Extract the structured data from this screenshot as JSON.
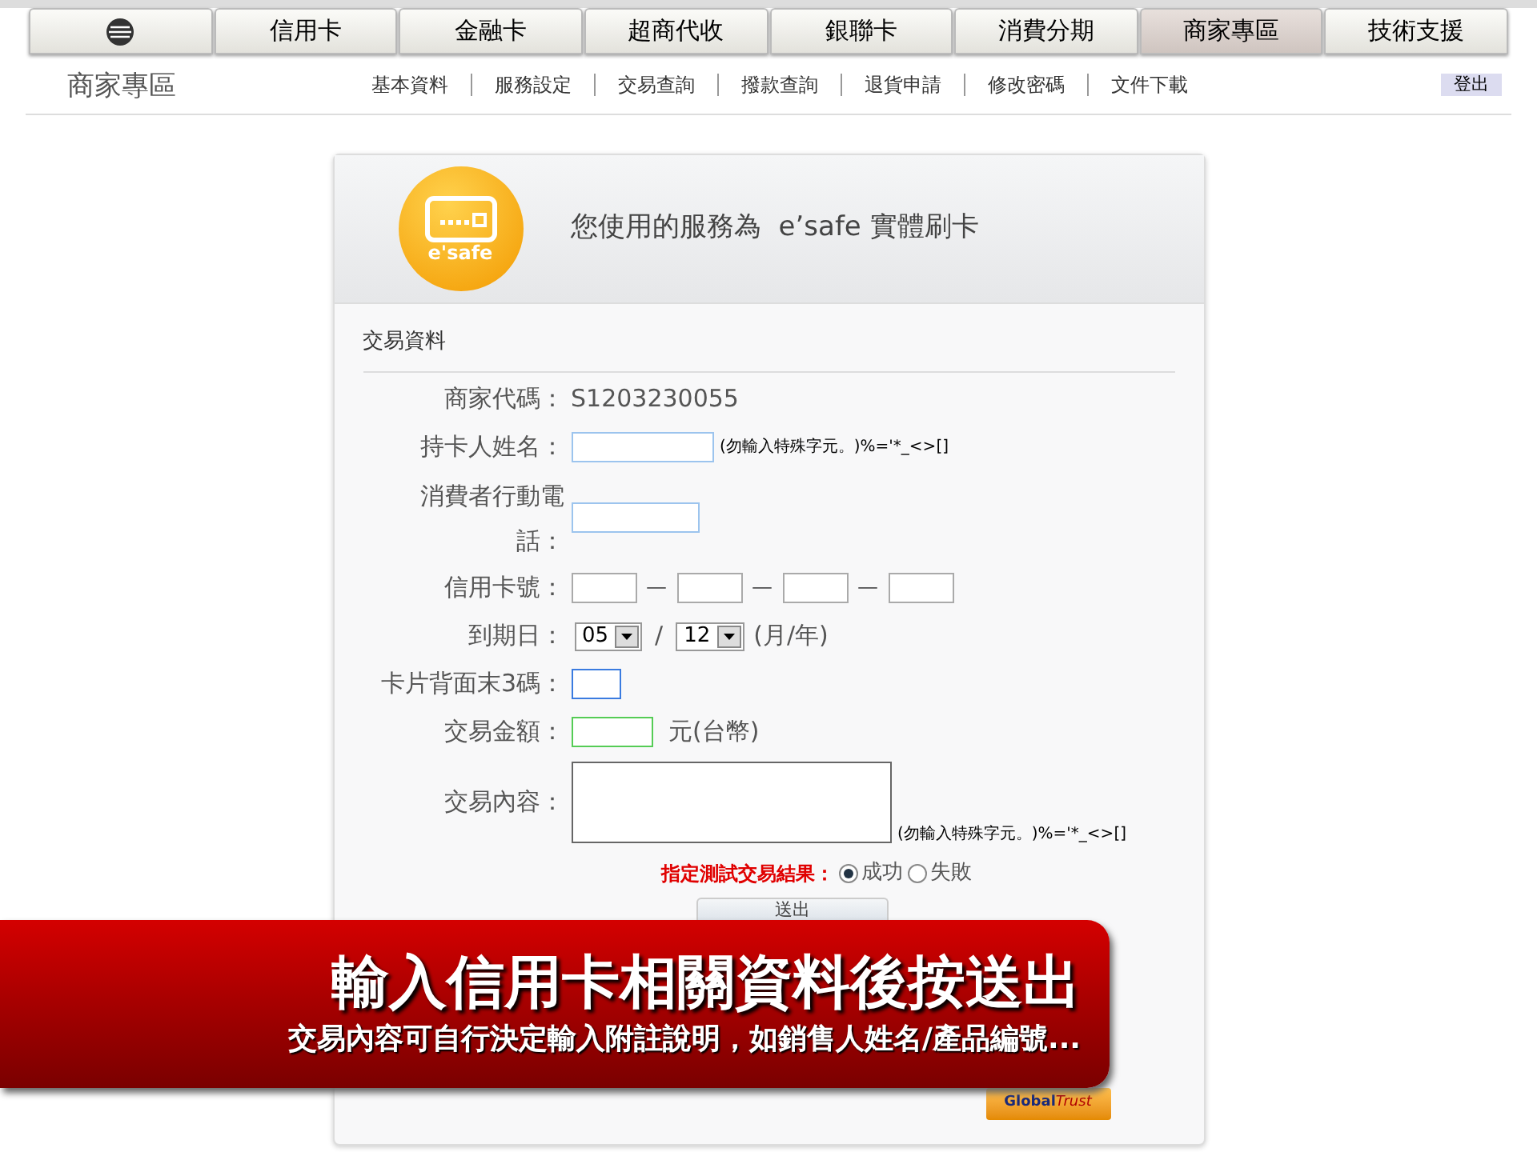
{
  "nav_tabs": [
    {
      "kind": "icon",
      "selected": false
    },
    {
      "kind": "text",
      "label": "信用卡",
      "selected": false
    },
    {
      "kind": "text",
      "label": "金融卡",
      "selected": false
    },
    {
      "kind": "text",
      "label": "超商代收",
      "selected": false
    },
    {
      "kind": "text",
      "label": "銀聯卡",
      "selected": false
    },
    {
      "kind": "text",
      "label": "消費分期",
      "selected": false
    },
    {
      "kind": "text",
      "label": "商家專區",
      "selected": true
    },
    {
      "kind": "text",
      "label": "技術支援",
      "selected": false
    }
  ],
  "section_title": "商家專區",
  "sub_links": [
    "基本資料",
    "服務設定",
    "交易查詢",
    "撥款查詢",
    "退貨申請",
    "修改密碼",
    "文件下載"
  ],
  "logout": "登出",
  "card": {
    "logo_text": "e'safe",
    "heading": "您使用的服務為  e’safe 實體刷卡",
    "section": "交易資料",
    "rows": [
      {
        "kind": "value",
        "label": "商家代碼：",
        "value": "S1203230055"
      },
      {
        "kind": "text_hint",
        "label": "持卡人姓名：",
        "hint": "(勿輸入特殊字元。)%='*_<>[]"
      },
      {
        "kind": "phone",
        "label_lines": [
          "消費者行動電",
          "話："
        ]
      },
      {
        "kind": "card_number",
        "label": "信用卡號：",
        "separator": "—"
      },
      {
        "kind": "expiry",
        "label": "到期日：",
        "month": "05",
        "year": "12",
        "slash": "/",
        "unit": "(月/年)"
      },
      {
        "kind": "cvv",
        "label": "卡片背面末3碼："
      },
      {
        "kind": "amount",
        "label": "交易金額：",
        "unit": "元(台幣)"
      },
      {
        "kind": "textarea",
        "label": "交易內容：",
        "hint": "(勿輸入特殊字元。)%='*_<>[]"
      }
    ],
    "result": {
      "label": "指定測試交易結果：",
      "options": [
        {
          "label": "成功",
          "selected": true
        },
        {
          "label": "失敗",
          "selected": false
        }
      ]
    },
    "submit": "送出",
    "badge": {
      "part_1": "Global",
      "part_2": "Trust"
    }
  },
  "banner": {
    "title": "輸入信用卡相關資料後按送出",
    "subtitle": "交易內容可自行決定輸入附註說明，如銷售人姓名/產品編號..."
  }
}
